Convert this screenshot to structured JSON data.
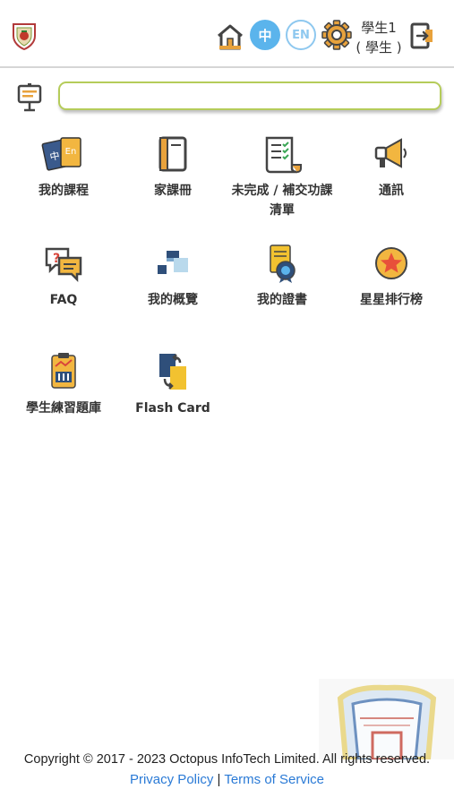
{
  "header": {
    "logo_icon": "school-crest-icon",
    "home_icon": "home-icon",
    "lang_zh": "中",
    "lang_en": "EN",
    "settings_icon": "gear-icon",
    "user_name": "學生1",
    "user_role": "( 學生 )",
    "logout_icon": "logout-icon",
    "accent_color": "#5bb4ec"
  },
  "search": {
    "board_icon": "notice-board-icon",
    "value": "",
    "border_color": "#b5cc5a"
  },
  "menu": {
    "items": [
      {
        "label": "我的課程",
        "icon": "books-icon"
      },
      {
        "label": "家課冊",
        "icon": "notebook-icon"
      },
      {
        "label": "未完成 / 補交功課清單",
        "icon": "checklist-icon"
      },
      {
        "label": "通訊",
        "icon": "megaphone-icon"
      },
      {
        "label": "FAQ",
        "icon": "faq-chat-icon"
      },
      {
        "label": "我的概覽",
        "icon": "overview-blocks-icon"
      },
      {
        "label": "我的證書",
        "icon": "certificate-icon"
      },
      {
        "label": "星星排行榜",
        "icon": "star-badge-icon"
      },
      {
        "label": "學生練習題庫",
        "icon": "question-bank-icon"
      },
      {
        "label": "Flash Card",
        "icon": "flash-card-icon"
      }
    ]
  },
  "footer": {
    "copyright": "Copyright © 2017 - 2023 Octopus InfoTech Limited. All rights reserved.",
    "privacy": "Privacy Policy",
    "separator": "|",
    "terms": "Terms of Service",
    "watermark_icon": "school-emblem-watermark"
  }
}
